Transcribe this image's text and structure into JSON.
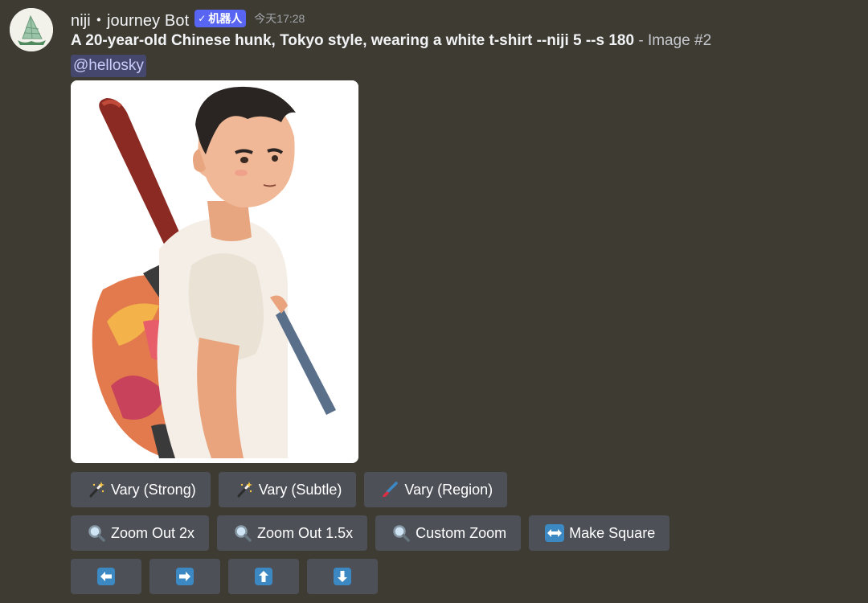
{
  "message": {
    "author": "niji・journey Bot",
    "bot_tag": "机器人",
    "bot_tag_icon": "check-icon",
    "timestamp": "今天17:28",
    "prompt": "A 20-year-old Chinese hunk, Tokyo style, wearing a white t-shirt --niji 5 --s 180",
    "image_suffix": " - Image #2",
    "mention": "@hellosky",
    "avatar_icon": "sailboat-logo-icon",
    "image_description_icon": "generated-image"
  },
  "buttons": {
    "row1": [
      {
        "label": "Vary (Strong)",
        "icon": "magic-wand-icon"
      },
      {
        "label": "Vary (Subtle)",
        "icon": "magic-wand-icon"
      },
      {
        "label": "Vary (Region)",
        "icon": "paintbrush-icon"
      }
    ],
    "row2": [
      {
        "label": "Zoom Out 2x",
        "icon": "magnifier-icon"
      },
      {
        "label": "Zoom Out 1.5x",
        "icon": "magnifier-icon"
      },
      {
        "label": "Custom Zoom",
        "icon": "magnifier-icon"
      },
      {
        "label": "Make Square",
        "icon": "left-right-arrow-icon"
      }
    ],
    "row3": [
      {
        "icon": "arrow-left-icon"
      },
      {
        "icon": "arrow-right-icon"
      },
      {
        "icon": "arrow-up-icon"
      },
      {
        "icon": "arrow-down-icon"
      }
    ]
  },
  "colors": {
    "background": "#3e3b33",
    "button": "#4e5058",
    "bot_tag": "#5865f2",
    "mention_bg": "rgba(88,101,242,0.3)",
    "arrow_key": "#3b88c3"
  }
}
